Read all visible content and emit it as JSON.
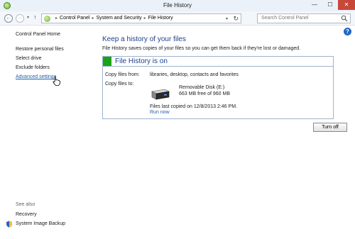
{
  "window": {
    "title": "File History",
    "minimize_glyph": "—",
    "maximize_glyph": "☐",
    "close_glyph": "✕"
  },
  "nav": {
    "back_glyph": "←",
    "forward_glyph": "→",
    "dropdown_glyph": "▾",
    "up_glyph": "↑",
    "breadcrumbs": [
      "Control Panel",
      "System and Security",
      "File History"
    ],
    "separator": "▸",
    "refresh_glyph": "↻",
    "search_placeholder": "Search Control Panel"
  },
  "sidebar": {
    "home": "Control Panel Home",
    "links": [
      "Restore personal files",
      "Select drive",
      "Exclude folders",
      "Advanced settings"
    ],
    "see_also_heading": "See also",
    "see_also_links": [
      "Recovery",
      "System Image Backup"
    ]
  },
  "main": {
    "heading": "Keep a history of your files",
    "description": "File History saves copies of your files so you can get them back if they're lost or damaged.",
    "help_glyph": "?",
    "status": "File History is on",
    "copy_from_label": "Copy files from:",
    "copy_from_value": "libraries, desktop, contacts and favorites",
    "copy_to_label": "Copy files to:",
    "drive_name": "Removable Disk (E:)",
    "drive_space": "663 MB free of 960 MB",
    "last_copied": "Files last copied on 12/8/2013 2:46 PM.",
    "run_now": "Run now",
    "turn_off": "Turn off"
  },
  "colors": {
    "status_green": "#1aa31a",
    "heading_blue": "#1e3f8a",
    "link_blue": "#1f5fa8",
    "close_red": "#c7483a"
  }
}
